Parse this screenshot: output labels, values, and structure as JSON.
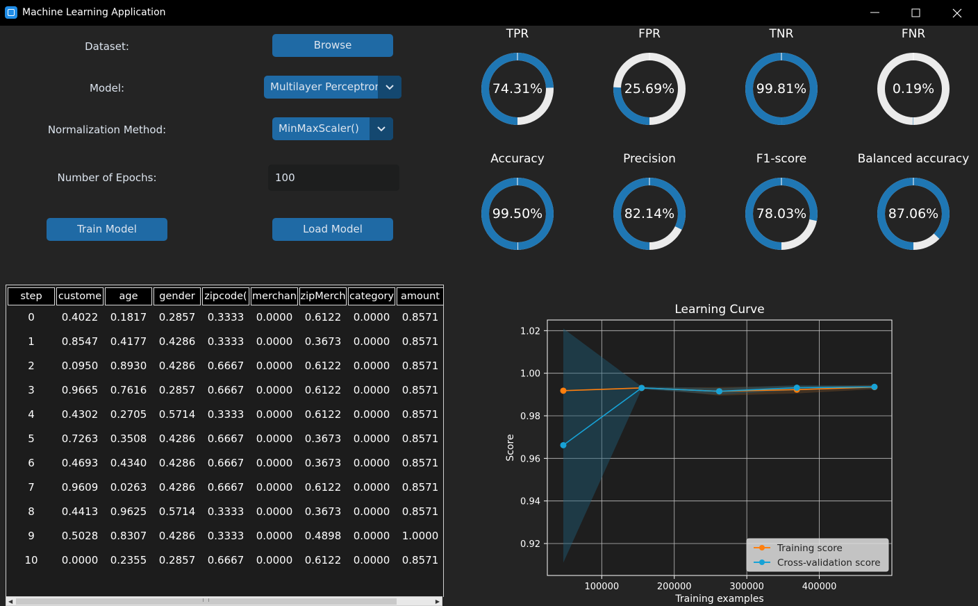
{
  "window": {
    "title": "Machine Learning Application"
  },
  "form": {
    "dataset_label": "Dataset:",
    "browse_button": "Browse",
    "model_label": "Model:",
    "model_value": "Multilayer Perceptron",
    "normalization_label": "Normalization Method:",
    "normalization_value": "MinMaxScaler()",
    "epochs_label": "Number of Epochs:",
    "epochs_value": "100",
    "train_button": "Train Model",
    "load_button": "Load Model"
  },
  "table": {
    "columns": [
      "step",
      "custome",
      "age",
      "gender",
      "zipcode(",
      "merchan",
      "zipMerch",
      "category",
      "amount"
    ],
    "rows": [
      [
        "0",
        "0.4022",
        "0.1817",
        "0.2857",
        "0.3333",
        "0.0000",
        "0.6122",
        "0.0000",
        "0.8571"
      ],
      [
        "1",
        "0.8547",
        "0.4177",
        "0.4286",
        "0.3333",
        "0.0000",
        "0.3673",
        "0.0000",
        "0.8571"
      ],
      [
        "2",
        "0.0950",
        "0.8930",
        "0.4286",
        "0.6667",
        "0.0000",
        "0.6122",
        "0.0000",
        "0.8571"
      ],
      [
        "3",
        "0.9665",
        "0.7616",
        "0.2857",
        "0.6667",
        "0.0000",
        "0.6122",
        "0.0000",
        "0.8571"
      ],
      [
        "4",
        "0.4302",
        "0.2705",
        "0.5714",
        "0.3333",
        "0.0000",
        "0.6122",
        "0.0000",
        "0.8571"
      ],
      [
        "5",
        "0.7263",
        "0.3508",
        "0.4286",
        "0.6667",
        "0.0000",
        "0.3673",
        "0.0000",
        "0.8571"
      ],
      [
        "6",
        "0.4693",
        "0.4340",
        "0.4286",
        "0.6667",
        "0.0000",
        "0.3673",
        "0.0000",
        "0.8571"
      ],
      [
        "7",
        "0.9609",
        "0.0263",
        "0.4286",
        "0.6667",
        "0.0000",
        "0.6122",
        "0.0000",
        "0.8571"
      ],
      [
        "8",
        "0.4413",
        "0.9625",
        "0.5714",
        "0.3333",
        "0.0000",
        "0.3673",
        "0.0000",
        "0.8571"
      ],
      [
        "9",
        "0.5028",
        "0.8307",
        "0.4286",
        "0.3333",
        "0.0000",
        "0.4898",
        "0.0000",
        "1.0000"
      ],
      [
        "10",
        "0.0000",
        "0.2355",
        "0.2857",
        "0.6667",
        "0.0000",
        "0.6122",
        "0.0000",
        "0.8571"
      ]
    ]
  },
  "metrics": [
    {
      "name": "TPR",
      "value": 74.31,
      "label": "74.31%"
    },
    {
      "name": "FPR",
      "value": 25.69,
      "label": "25.69%"
    },
    {
      "name": "TNR",
      "value": 99.81,
      "label": "99.81%"
    },
    {
      "name": "FNR",
      "value": 0.19,
      "label": "0.19%"
    },
    {
      "name": "Accuracy",
      "value": 99.5,
      "label": "99.50%"
    },
    {
      "name": "Precision",
      "value": 82.14,
      "label": "82.14%"
    },
    {
      "name": "F1-score",
      "value": 78.03,
      "label": "78.03%"
    },
    {
      "name": "Balanced accuracy",
      "value": 87.06,
      "label": "87.06%"
    }
  ],
  "colors": {
    "accent": "#1f6aa5",
    "donut_fill": "#1f77b4",
    "donut_track": "#ebebeb",
    "training_line": "#ff7f0e",
    "cv_line": "#17a2d6"
  },
  "chart_data": {
    "type": "line",
    "title": "Learning Curve",
    "xlabel": "Training examples",
    "ylabel": "Score",
    "xlim": [
      25000,
      500000
    ],
    "ylim": [
      0.905,
      1.025
    ],
    "xticks": [
      100000,
      200000,
      300000,
      400000
    ],
    "xtick_labels": [
      "100000",
      "200000",
      "300000",
      "400000"
    ],
    "yticks": [
      0.92,
      0.94,
      0.96,
      0.98,
      1.0,
      1.02
    ],
    "ytick_labels": [
      "0.92",
      "0.94",
      "0.96",
      "0.98",
      "1.00",
      "1.02"
    ],
    "grid": true,
    "legend_position": "lower-right",
    "x": [
      47000,
      155000,
      262000,
      369000,
      476000
    ],
    "series": [
      {
        "name": "Training score",
        "values": [
          0.9918,
          0.9931,
          0.9915,
          0.9923,
          0.9935
        ],
        "band": [
          [
            0.9918,
            0.9918
          ],
          [
            0.9931,
            0.9931
          ],
          [
            0.9895,
            0.9935
          ],
          [
            0.9905,
            0.994
          ],
          [
            0.9925,
            0.9945
          ]
        ]
      },
      {
        "name": "Cross-validation score",
        "values": [
          0.9662,
          0.9931,
          0.9915,
          0.9932,
          0.9936
        ],
        "band": [
          [
            0.911,
            1.021
          ],
          [
            0.9925,
            0.9937
          ],
          [
            0.99,
            0.993
          ],
          [
            0.992,
            0.9944
          ],
          [
            0.993,
            0.9942
          ]
        ]
      }
    ]
  }
}
